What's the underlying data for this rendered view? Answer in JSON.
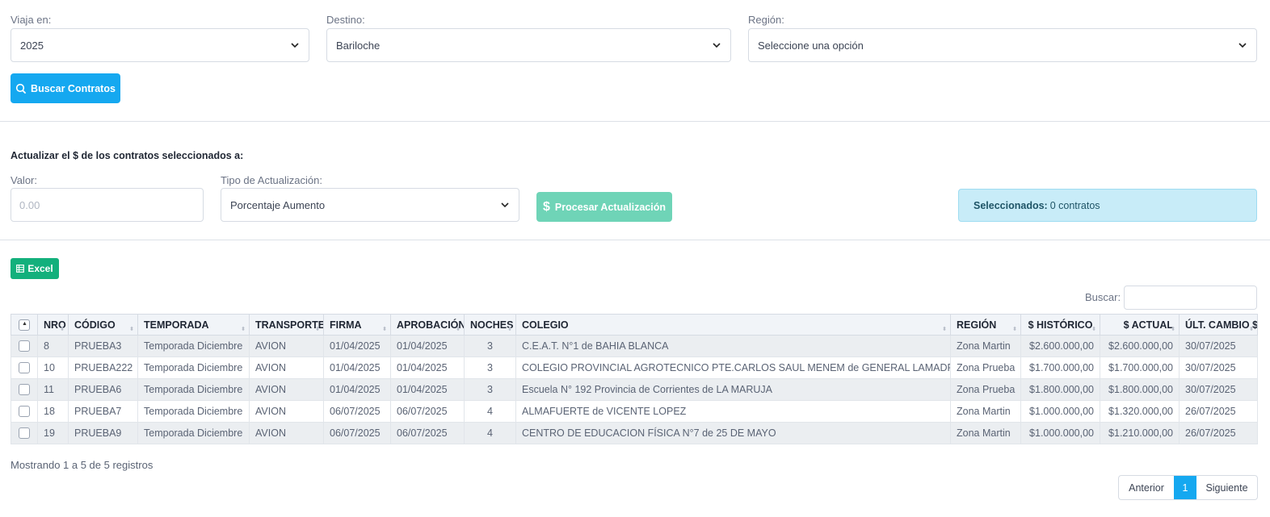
{
  "filters": {
    "viaja_label": "Viaja en:",
    "viaja_value": "2025",
    "destino_label": "Destino:",
    "destino_value": "Bariloche",
    "region_label": "Región:",
    "region_value": "Seleccione una opción",
    "search_button": "Buscar Contratos"
  },
  "update": {
    "title": "Actualizar el $ de los contratos seleccionados a:",
    "valor_label": "Valor:",
    "valor_placeholder": "0.00",
    "tipo_label": "Tipo de Actualización:",
    "tipo_value": "Porcentaje Aumento",
    "process_button": "Procesar Actualización",
    "selected_label": "Seleccionados:",
    "selected_value": "0 contratos"
  },
  "table": {
    "excel_button": "Excel",
    "search_label": "Buscar:",
    "columns": [
      "NRO",
      "CÓDIGO",
      "TEMPORADA",
      "TRANSPORTE",
      "FIRMA",
      "APROBACIÓN",
      "NOCHES",
      "COLEGIO",
      "REGIÓN",
      "$ HISTÓRICO",
      "$ ACTUAL",
      "ÚLT. CAMBIO $"
    ],
    "rows": [
      {
        "nro": "8",
        "codigo": "PRUEBA3",
        "temporada": "Temporada Diciembre",
        "transporte": "AVION",
        "firma": "01/04/2025",
        "aprobacion": "01/04/2025",
        "noches": "3",
        "colegio": "C.E.A.T. N°1 de BAHIA BLANCA",
        "region": "Zona Martin",
        "historico": "$2.600.000,00",
        "actual": "$2.600.000,00",
        "ult_cambio": "30/07/2025"
      },
      {
        "nro": "10",
        "codigo": "PRUEBA222",
        "temporada": "Temporada Diciembre",
        "transporte": "AVION",
        "firma": "01/04/2025",
        "aprobacion": "01/04/2025",
        "noches": "3",
        "colegio": "COLEGIO PROVINCIAL AGROTECNICO PTE.CARLOS SAUL MENEM de GENERAL LAMADRID",
        "region": "Zona Prueba",
        "historico": "$1.700.000,00",
        "actual": "$1.700.000,00",
        "ult_cambio": "30/07/2025"
      },
      {
        "nro": "11",
        "codigo": "PRUEBA6",
        "temporada": "Temporada Diciembre",
        "transporte": "AVION",
        "firma": "01/04/2025",
        "aprobacion": "01/04/2025",
        "noches": "3",
        "colegio": "Escuela N° 192 Provincia de Corrientes de LA MARUJA",
        "region": "Zona Prueba",
        "historico": "$1.800.000,00",
        "actual": "$1.800.000,00",
        "ult_cambio": "30/07/2025"
      },
      {
        "nro": "18",
        "codigo": "PRUEBA7",
        "temporada": "Temporada Diciembre",
        "transporte": "AVION",
        "firma": "06/07/2025",
        "aprobacion": "06/07/2025",
        "noches": "4",
        "colegio": "ALMAFUERTE de VICENTE LOPEZ",
        "region": "Zona Martin",
        "historico": "$1.000.000,00",
        "actual": "$1.320.000,00",
        "ult_cambio": "26/07/2025"
      },
      {
        "nro": "19",
        "codigo": "PRUEBA9",
        "temporada": "Temporada Diciembre",
        "transporte": "AVION",
        "firma": "06/07/2025",
        "aprobacion": "06/07/2025",
        "noches": "4",
        "colegio": "CENTRO DE EDUCACION FÍSICA N°7 de 25 DE MAYO",
        "region": "Zona Martin",
        "historico": "$1.000.000,00",
        "actual": "$1.210.000,00",
        "ult_cambio": "26/07/2025"
      }
    ],
    "info": "Mostrando 1 a 5 de 5 registros",
    "pager": {
      "prev": "Anterior",
      "page": "1",
      "next": "Siguiente"
    }
  },
  "colors": {
    "primary": "#15a8f0",
    "success": "#13b07c",
    "process_disabled": "#6fd4b7",
    "info_bg": "#c8ecf8"
  },
  "icons": [
    "chevron-down-icon",
    "search-icon",
    "dollar-icon",
    "spreadsheet-icon",
    "checkbox-icon"
  ]
}
